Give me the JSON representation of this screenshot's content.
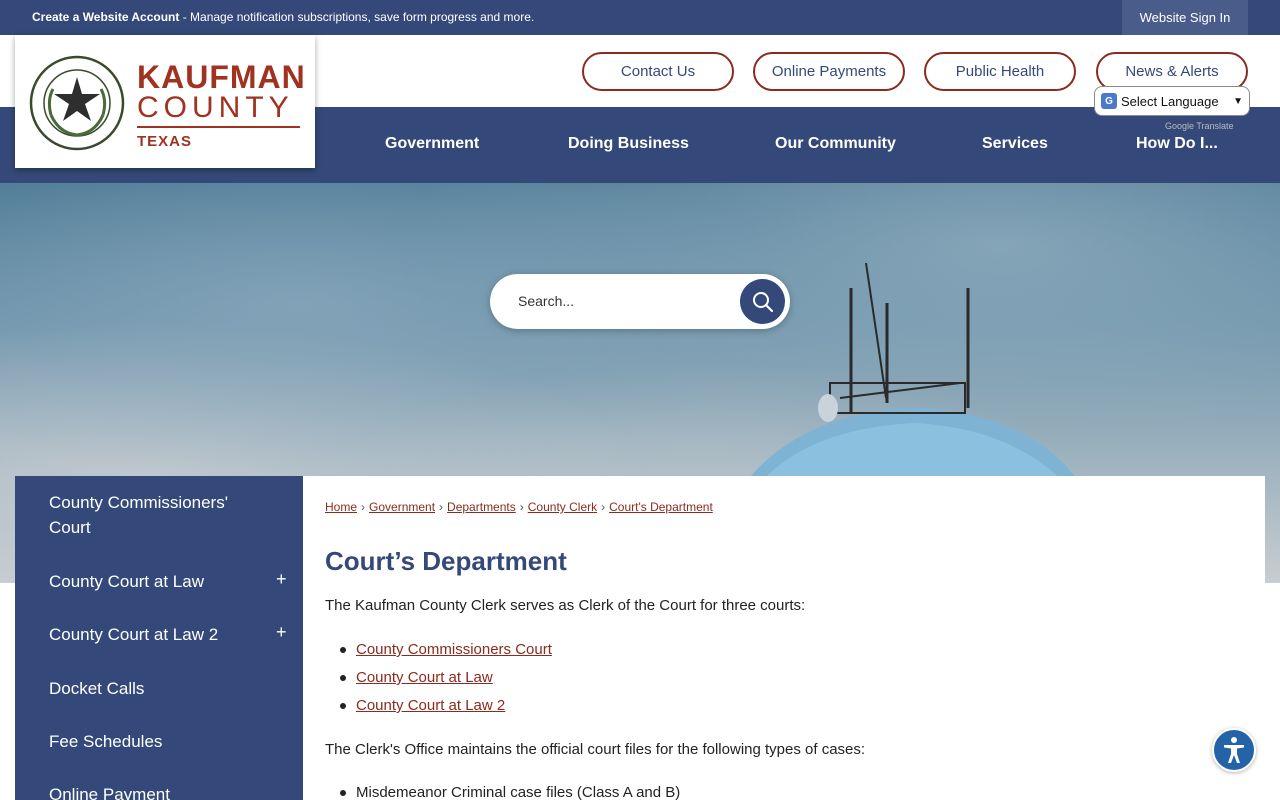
{
  "topbar": {
    "create_bold": "Create a Website Account",
    "create_rest": " - Manage notification subscriptions, save form progress and more.",
    "signin": "Website Sign In"
  },
  "logo": {
    "line1": "KAUFMAN",
    "line2": "COUNTY",
    "line3": "TEXAS",
    "seal_text_top": "THE STATE OF TEXAS",
    "seal_text_bottom": "KAUFMAN COUNTY"
  },
  "quick_links": [
    "Contact Us",
    "Online Payments",
    "Public Health",
    "News & Alerts"
  ],
  "translate": {
    "label": "Select Language",
    "powered_by": "Google Translate"
  },
  "nav": [
    "Government",
    "Doing Business",
    "Our Community",
    "Services",
    "How Do I..."
  ],
  "search": {
    "placeholder": "Search..."
  },
  "sidebar": {
    "items": [
      {
        "label": "County Commissioners' Court",
        "toggle": ""
      },
      {
        "label": "County Court at Law",
        "toggle": "+"
      },
      {
        "label": "County Court at Law 2",
        "toggle": "+"
      },
      {
        "label": "Docket Calls",
        "toggle": ""
      },
      {
        "label": "Fee Schedules",
        "toggle": ""
      },
      {
        "label": "Online Payment",
        "toggle": ""
      }
    ]
  },
  "breadcrumb": [
    "Home",
    "Government",
    "Departments",
    "County Clerk",
    "Court's Department"
  ],
  "main": {
    "title": "Court’s Department",
    "intro": "The Kaufman County Clerk serves as Clerk of the Court for three courts:",
    "courts": [
      "County Commissioners Court",
      "County Court at Law",
      "County Court at Law 2"
    ],
    "files_intro": "The Clerk's Office maintains the official court files for the following types of cases:",
    "case_types": [
      "Misdemeanor Criminal case files (Class A and B)"
    ]
  },
  "colors": {
    "navy": "#34497a",
    "brand_red": "#a0321f",
    "link": "#8b2a1e",
    "a11y": "#2563a8"
  }
}
